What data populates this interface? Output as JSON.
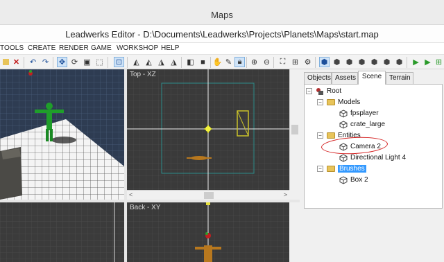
{
  "window": {
    "tab_title": "Maps",
    "title": "Leadwerks Editor - D:\\Documents\\Leadwerks\\Projects\\Planets\\Maps\\start.map"
  },
  "menubar": {
    "items": [
      "TOOLS",
      "CREATE",
      "RENDER",
      "GAME",
      "WORKSHOP",
      "HELP"
    ]
  },
  "toolbar": {
    "icons": [
      "open-icon",
      "delete-icon",
      "undo-icon",
      "redo-icon",
      "move-icon",
      "rotate-icon",
      "scale-icon",
      "select-icon",
      "snap-icon",
      "align-icon",
      "align-icon",
      "align-icon",
      "align-icon",
      "group-icon",
      "ungroup-icon",
      "paint-icon",
      "pick-icon",
      "lock-icon",
      "zoom-in-icon",
      "zoom-out-icon",
      "zoom-extents-icon",
      "grid-icon",
      "settings-icon",
      "box-icon",
      "box-icon",
      "box-icon",
      "box-icon",
      "box-icon",
      "box-icon",
      "play-icon",
      "play-debug-icon",
      "publish-icon"
    ]
  },
  "viewports": {
    "top_label": "Top - XZ",
    "back_label": "Back - XY"
  },
  "panel": {
    "tabs": [
      "Objects",
      "Assets",
      "Scene",
      "Terrain"
    ],
    "active_tab": "Scene",
    "tree": {
      "root": "Root",
      "models": "Models",
      "fpsplayer": "fpsplayer",
      "crate": "crate_large",
      "entities": "Entities",
      "camera": "Camera 2",
      "light": "Directional Light 4",
      "brushes": "Brushes",
      "box": "Box 2"
    },
    "selected": "Brushes"
  },
  "colors": {
    "selection": "#3399ff",
    "annotation": "#d42020",
    "viewport_bg": "#3a3a3a",
    "sky": "#2f3e55"
  }
}
